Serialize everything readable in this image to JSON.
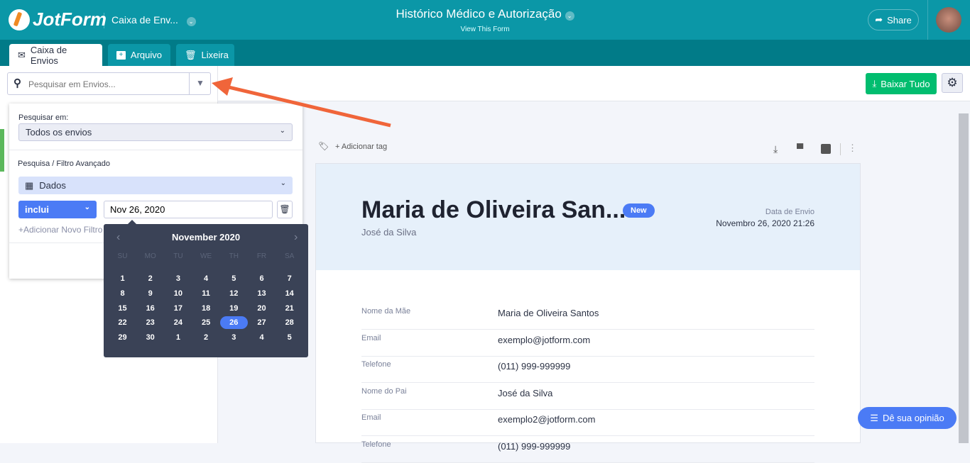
{
  "header": {
    "logo": "JotForm",
    "form_short": "Caixa de Env...",
    "title": "Histórico Médico e Autorização",
    "subtitle": "View This Form",
    "share": "Share"
  },
  "tabs": [
    {
      "label": "Caixa de Envios"
    },
    {
      "label": "Arquivo"
    },
    {
      "label": "Lixeira"
    }
  ],
  "search": {
    "placeholder": "Pesquisar em Envios..."
  },
  "toolbar": {
    "download_all": "Baixar Tudo"
  },
  "filter": {
    "search_in_label": "Pesquisar em:",
    "search_in_value": "Todos os envios",
    "advanced_label": "Pesquisa / Filtro Avançado",
    "field": "Dados",
    "operator": "inclui",
    "value": "Nov 26, 2020",
    "add_filter": "+Adicionar Novo Filtro"
  },
  "calendar": {
    "month": "November 2020",
    "weekdays": [
      "SU",
      "MO",
      "TU",
      "WE",
      "TH",
      "FR",
      "SA"
    ],
    "weeks": [
      [
        "1",
        "2",
        "3",
        "4",
        "5",
        "6",
        "7"
      ],
      [
        "8",
        "9",
        "10",
        "11",
        "12",
        "13",
        "14"
      ],
      [
        "15",
        "16",
        "17",
        "18",
        "19",
        "20",
        "21"
      ],
      [
        "22",
        "23",
        "24",
        "25",
        "26",
        "27",
        "28"
      ],
      [
        "29",
        "30",
        "1",
        "2",
        "3",
        "4",
        "5"
      ]
    ],
    "selected": "26"
  },
  "submission": {
    "add_tag": "+ Adicionar tag",
    "name": "Maria de Oliveira San...",
    "badge": "New",
    "sub": "José da Silva",
    "date_label": "Data de Envio",
    "date": "Novembro 26, 2020 21:26",
    "fields": [
      {
        "k": "Nome da Mãe",
        "v": "Maria de Oliveira Santos"
      },
      {
        "k": "Email",
        "v": "exemplo@jotform.com"
      },
      {
        "k": "Telefone",
        "v": "(011) 999-999999"
      },
      {
        "k": "Nome do Pai",
        "v": "José da Silva"
      },
      {
        "k": "Email",
        "v": "exemplo2@jotform.com"
      },
      {
        "k": "Telefone",
        "v": "(011) 999-999999"
      }
    ]
  },
  "feedback": "Dê sua opinião",
  "colors": {
    "header": "#0b97a7",
    "tabbar": "#017b88",
    "green": "#01bd6f",
    "blue": "#4b7bf5",
    "arrow": "#f0653a"
  }
}
